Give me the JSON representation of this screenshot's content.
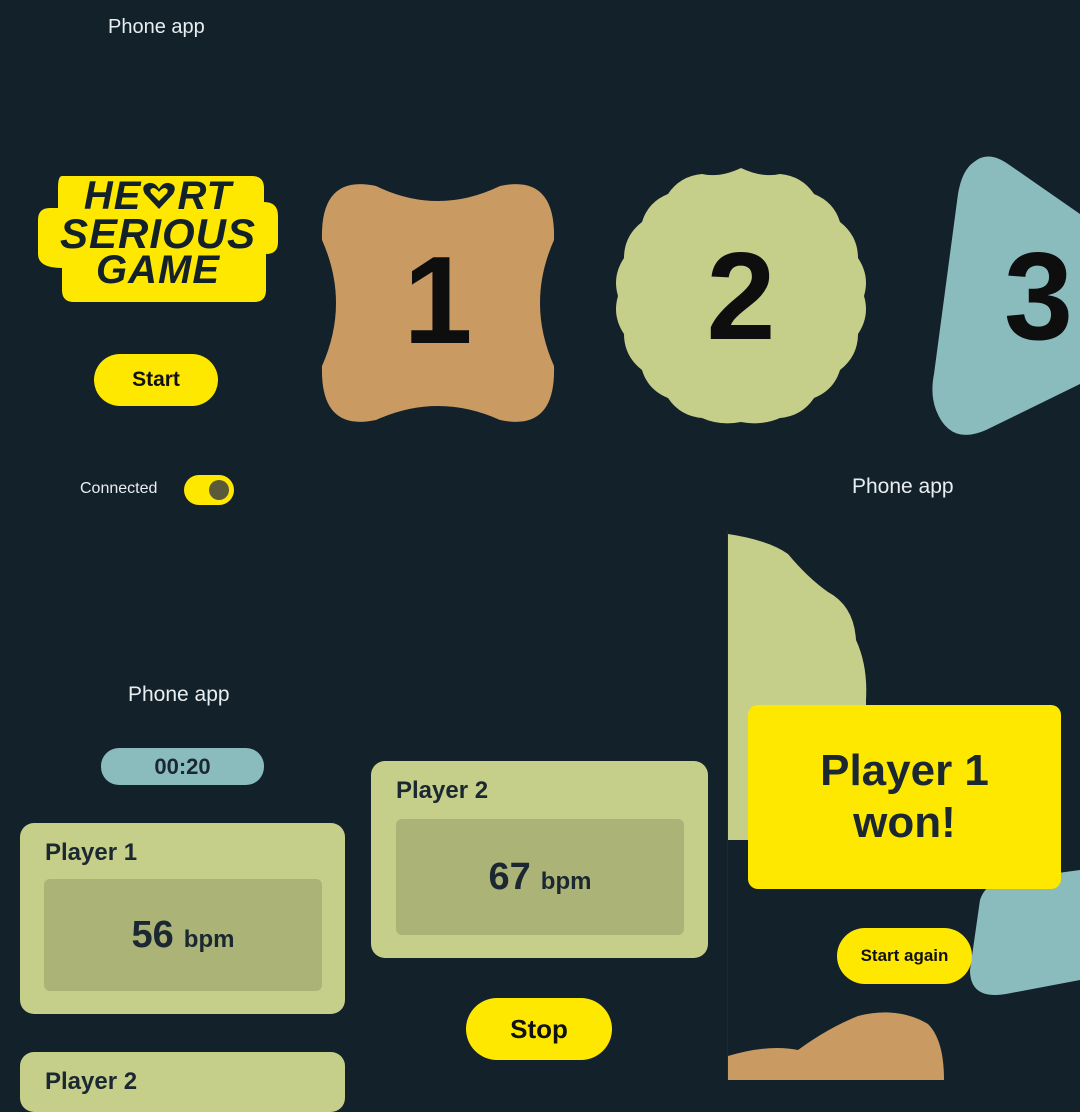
{
  "screen_top": {
    "app_label": "Phone app",
    "logo": {
      "text_lines": [
        "HEART",
        "SERIOUS",
        "GAME"
      ],
      "heart_icon": "heart-icon"
    },
    "start_label": "Start",
    "connected_label": "Connected",
    "connected_on": true,
    "countdown": [
      "1",
      "2",
      "3"
    ]
  },
  "screen_game": {
    "app_label": "Phone app",
    "timer": "00:20",
    "players": [
      {
        "name": "Player 1",
        "bpm": "56",
        "unit": "bpm"
      },
      {
        "name": "Player 2",
        "bpm": "67",
        "unit": "bpm"
      }
    ],
    "partial_player_label": "Player 2",
    "stop_label": "Stop"
  },
  "screen_result": {
    "app_label": "Phone app",
    "result_text": "Player 1 won!",
    "start_again_label": "Start again"
  },
  "colors": {
    "background": "#13212b",
    "accent_yellow": "#ffe800",
    "card_green": "#c5cf8a",
    "bpm_box": "#abb377",
    "shape_orange": "#c99a62",
    "shape_green": "#c5cf8a",
    "shape_teal": "#8bbcbd",
    "timer_pill": "#8bbcbd"
  }
}
